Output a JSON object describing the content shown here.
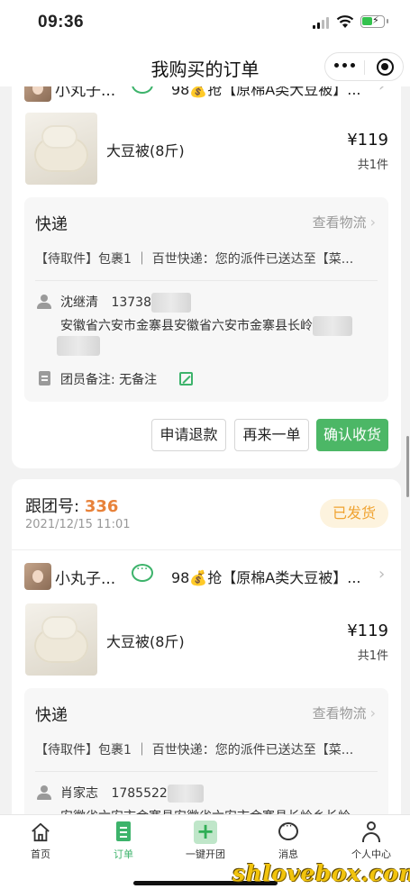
{
  "status_bar": {
    "time": "09:36"
  },
  "nav": {
    "title": "我购买的订单"
  },
  "orders": [
    {
      "seller_name": "小丸子...",
      "group_title": "98💰抢【原棉A类大豆被】...",
      "product_name": "大豆被(8斤)",
      "price": "¥119",
      "quantity": "共1件",
      "express_title": "快递",
      "track_label": "查看物流",
      "express_status": "【待取件】包裹1 ｜ 百世快递：您的派件已送达至【菜...",
      "recipient_name": "沈继清",
      "recipient_phone": "13738",
      "address": "安徽省六安市金寨县安徽省六安市金寨县长岭",
      "note_label": "团员备注: 无备注",
      "buttons": {
        "refund": "申请退款",
        "reorder": "再来一单",
        "confirm": "确认收货"
      }
    },
    {
      "group_label": "跟团号:",
      "group_number": "336",
      "order_time": "2021/12/15 11:01",
      "status_badge": "已发货",
      "seller_name": "小丸子...",
      "group_title": "98💰抢【原棉A类大豆被】...",
      "product_name": "大豆被(8斤)",
      "price": "¥119",
      "quantity": "共1件",
      "express_title": "快递",
      "track_label": "查看物流",
      "express_status": "【待取件】包裹1 ｜ 百世快递：您的派件已送达至【菜...",
      "recipient_name": "肖家志",
      "recipient_phone": "1785522",
      "address": "安徽省六安市金寨县安徽省六安市金寨县长岭乡长岭"
    }
  ],
  "tabbar": [
    {
      "label": "首页",
      "icon": "home-icon"
    },
    {
      "label": "订单",
      "icon": "order-icon",
      "active": true
    },
    {
      "label": "一键开团",
      "icon": "plus-icon"
    },
    {
      "label": "消息",
      "icon": "message-icon"
    },
    {
      "label": "个人中心",
      "icon": "user-icon"
    }
  ],
  "watermark": "shlovebox.com",
  "colors": {
    "accent_green": "#4cb766",
    "group_number_orange": "#e8823a",
    "badge_text": "#f0a331",
    "badge_bg": "#fdf3de"
  }
}
